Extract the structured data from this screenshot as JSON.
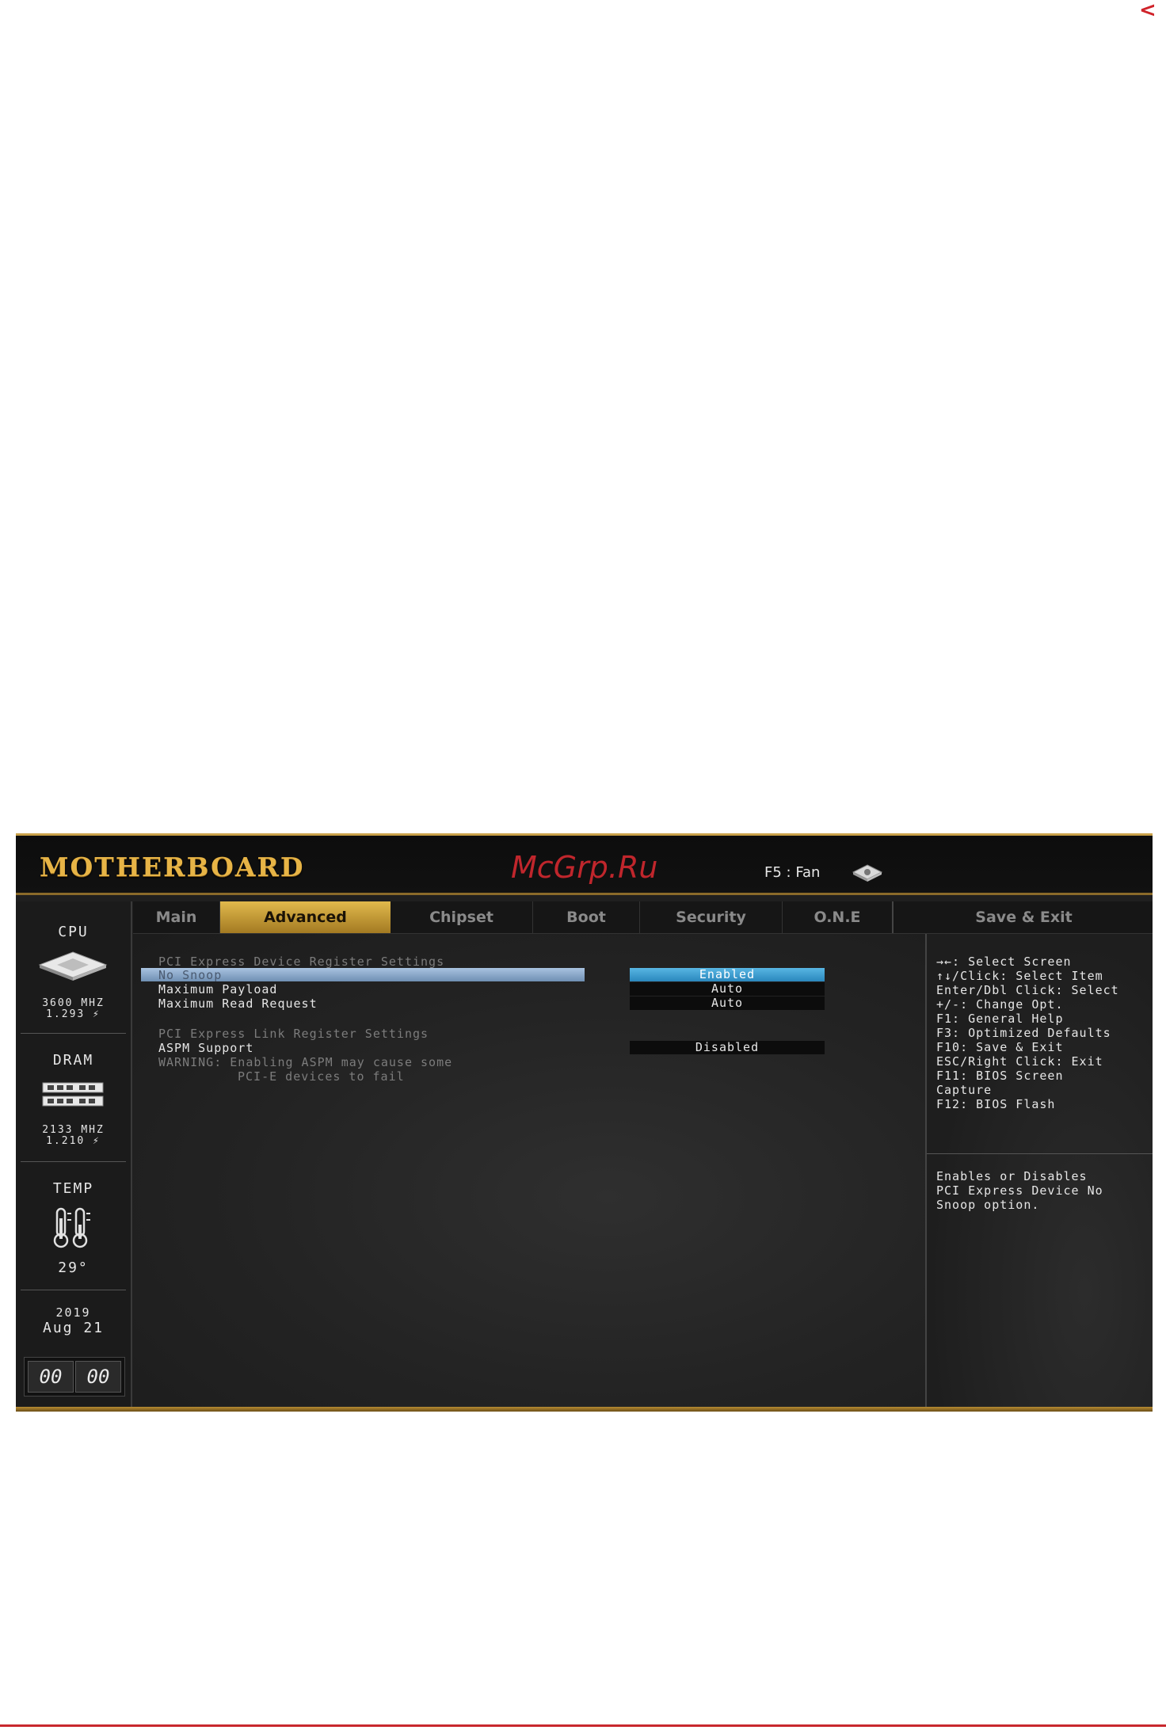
{
  "corner_glyph": "<",
  "header": {
    "logo": "MOTHERBOARD",
    "watermark": "McGrp.Ru",
    "fan_hint": "F5 : Fan"
  },
  "left_panel": {
    "cpu": {
      "title": "CPU",
      "freq": "3600 MHZ",
      "volt": "1.293 ⚡"
    },
    "dram": {
      "title": "DRAM",
      "freq": "2133 MHZ",
      "volt": "1.210 ⚡"
    },
    "temp": {
      "title": "TEMP",
      "value": "29°"
    },
    "date": {
      "year": "2019",
      "month_day": "Aug 21"
    },
    "clock": {
      "hours": "00",
      "minutes": "00"
    }
  },
  "tabs": [
    {
      "label": "Main"
    },
    {
      "label": "Advanced",
      "active": true
    },
    {
      "label": "Chipset"
    },
    {
      "label": "Boot"
    },
    {
      "label": "Security"
    },
    {
      "label": "O.N.E"
    },
    {
      "label": "Save & Exit"
    }
  ],
  "settings": {
    "device_header": "PCI Express Device Register Settings",
    "no_snoop": {
      "label": "No Snoop",
      "value": "Enabled"
    },
    "max_payload": {
      "label": "Maximum Payload",
      "value": "Auto"
    },
    "max_read": {
      "label": "Maximum Read Request",
      "value": "Auto"
    },
    "link_header": "PCI Express Link Register Settings",
    "aspm": {
      "label": "ASPM Support",
      "value": "Disabled"
    },
    "warning_1": "WARNING: Enabling ASPM may cause some",
    "warning_2": "PCI-E devices to fail"
  },
  "help_keys": [
    "→←: Select Screen",
    "↑↓/Click: Select Item",
    "Enter/Dbl Click: Select",
    "+/-: Change Opt.",
    "F1: General Help",
    "F3: Optimized Defaults",
    "F10: Save & Exit",
    "ESC/Right Click: Exit",
    "F11: BIOS Screen",
    "Capture",
    "F12: BIOS Flash"
  ],
  "description": [
    "Enables or Disables",
    "PCI Express Device No",
    "Snoop option."
  ],
  "colors": {
    "accent_gold": "#e1b94c",
    "selection_blue": "#2a87bd",
    "watermark_red": "#c0262c"
  }
}
